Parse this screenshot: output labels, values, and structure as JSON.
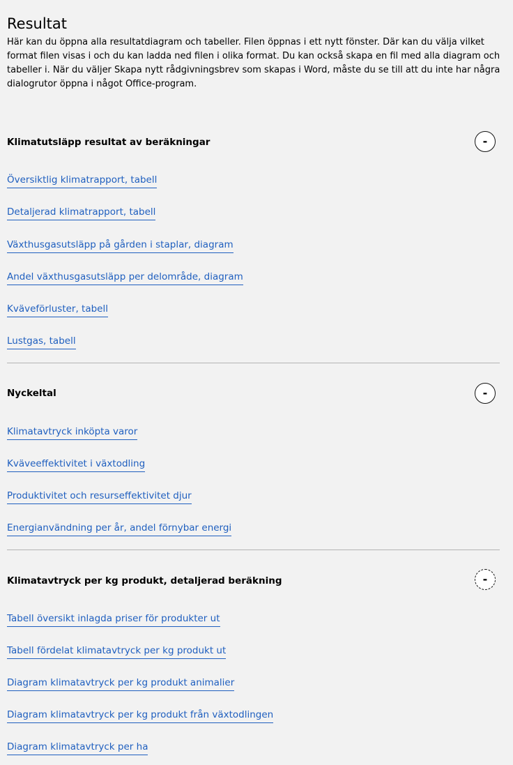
{
  "intro": {
    "title": "Resultat",
    "text": "Här kan du öppna alla resultatdiagram och tabeller. Filen öppnas i ett nytt fönster. Där kan du välja vilket format filen visas i och du kan ladda ned filen i olika format. Du kan också skapa en fil med alla diagram och tabeller i. När du väljer Skapa nytt rådgivningsbrev som skapas i Word, måste du se till att du inte har några dialogrutor öppna i något Office-program."
  },
  "sections": [
    {
      "title": "Klimatutsläpp resultat av beräkningar",
      "toggle": "-",
      "links": [
        "Översiktlig klimatrapport, tabell",
        "Detaljerad klimatrapport, tabell",
        "Växthusgasutsläpp på gården i staplar, diagram",
        "Andel växthusgasutsläpp per delområde, diagram",
        "Kväveförluster, tabell",
        "Lustgas, tabell"
      ]
    },
    {
      "title": "Nyckeltal",
      "toggle": "-",
      "links": [
        "Klimatavtryck inköpta varor",
        "Kväveeffektivitet i växtodling",
        "Produktivitet och resurseffektivitet djur",
        "Energianvändning per år, andel förnybar energi"
      ]
    },
    {
      "title": "Klimatavtryck per kg produkt, detaljerad beräkning",
      "toggle": "-",
      "links": [
        "Tabell översikt inlagda priser för produkter ut",
        "Tabell fördelat klimatavtryck per kg produkt ut",
        "Diagram klimatavtryck per kg produkt animalier",
        "Diagram klimatavtryck per kg produkt från växtodlingen",
        "Diagram klimatavtryck per ha"
      ]
    }
  ],
  "colors": {
    "background": "#f2f2f2",
    "link": "#1f5fbf",
    "divider": "#b3b3b3"
  },
  "icons": {
    "toggle": "collapse-minus-icon"
  }
}
